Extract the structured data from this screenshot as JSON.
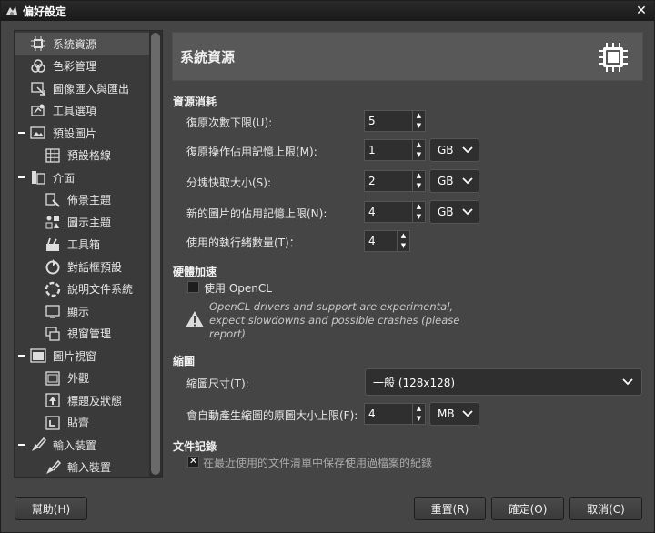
{
  "window": {
    "title": "偏好設定",
    "close_glyph": "✕"
  },
  "sidebar": {
    "items": [
      {
        "label": "系統資源",
        "icon": "chip-icon",
        "level": 0,
        "expander": false,
        "selected": true
      },
      {
        "label": "色彩管理",
        "icon": "color-icon",
        "level": 0,
        "expander": false
      },
      {
        "label": "圖像匯入與匯出",
        "icon": "import-icon",
        "level": 0,
        "expander": false
      },
      {
        "label": "工具選項",
        "icon": "tool-icon",
        "level": 0,
        "expander": false
      },
      {
        "label": "預設圖片",
        "icon": "image-icon",
        "level": 0,
        "expander": true
      },
      {
        "label": "預設格線",
        "icon": "grid-icon",
        "level": 1,
        "expander": false
      },
      {
        "label": "介面",
        "icon": "interface-icon",
        "level": 0,
        "expander": true
      },
      {
        "label": "佈景主題",
        "icon": "theme-icon",
        "level": 1,
        "expander": false
      },
      {
        "label": "圖示主題",
        "icon": "icon-theme-icon",
        "level": 1,
        "expander": false
      },
      {
        "label": "工具箱",
        "icon": "toolbox-icon",
        "level": 1,
        "expander": false
      },
      {
        "label": "對話框預設",
        "icon": "dialog-icon",
        "level": 1,
        "expander": false
      },
      {
        "label": "說明文件系統",
        "icon": "help-icon",
        "level": 1,
        "expander": false
      },
      {
        "label": "顯示",
        "icon": "display-icon",
        "level": 1,
        "expander": false
      },
      {
        "label": "視窗管理",
        "icon": "window-icon",
        "level": 1,
        "expander": false
      },
      {
        "label": "圖片視窗",
        "icon": "image-window-icon",
        "level": 0,
        "expander": true
      },
      {
        "label": "外觀",
        "icon": "appearance-icon",
        "level": 1,
        "expander": false
      },
      {
        "label": "標題及狀態",
        "icon": "title-status-icon",
        "level": 1,
        "expander": false
      },
      {
        "label": "貼齊",
        "icon": "snap-icon",
        "level": 1,
        "expander": false
      },
      {
        "label": "輸入裝置",
        "icon": "input-device-icon",
        "level": 0,
        "expander": true
      },
      {
        "label": "輸入裝置",
        "icon": "input-device-icon",
        "level": 1,
        "expander": false
      }
    ]
  },
  "page": {
    "title": "系統資源",
    "icon": "chip-icon"
  },
  "resource": {
    "section_title": "資源消耗",
    "undo_levels": {
      "label": "復原次數下限(U):",
      "value": "5"
    },
    "undo_memory": {
      "label": "復原操作佔用記憶上限(M):",
      "value": "1",
      "unit": "GB"
    },
    "tile_cache": {
      "label": "分塊快取大小(S):",
      "value": "2",
      "unit": "GB"
    },
    "max_image": {
      "label": "新的圖片的佔用記憶上限(N):",
      "value": "4",
      "unit": "GB"
    },
    "threads": {
      "label": "使用的執行緒數量(T)：",
      "value": "4"
    }
  },
  "hardware": {
    "section_title": "硬體加速",
    "opencl_label": "使用 OpenCL",
    "opencl_checked": false,
    "warning": "OpenCL drivers and support are experimental, expect slowdowns and possible crashes (please report)."
  },
  "thumbnails": {
    "section_title": "縮圖",
    "size": {
      "label": "縮圖尺寸(T):",
      "value": "一般 (128x128)"
    },
    "max_file": {
      "label": "會自動產生縮圖的原圖大小上限(F):",
      "value": "4",
      "unit": "MB"
    }
  },
  "history": {
    "section_title": "文件記錄",
    "keep_label": "在最近使用的文件清單中保存使用過檔案的紀錄",
    "keep_checked": true
  },
  "buttons": {
    "help": "幫助(H)",
    "reset": "重置(R)",
    "ok": "確定(O)",
    "cancel": "取消(C)"
  }
}
